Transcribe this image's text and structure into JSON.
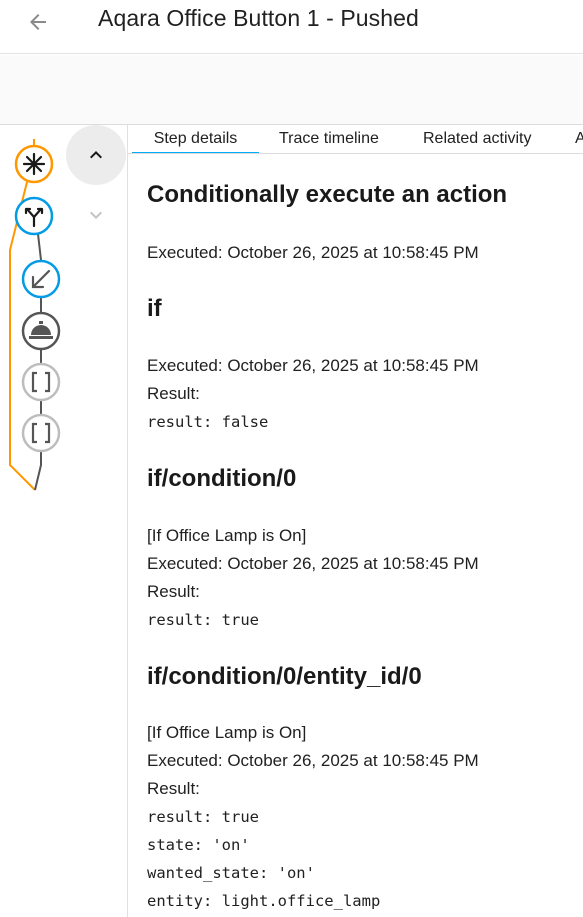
{
  "header": {
    "title": "Aqara Office Button 1 - Pushed",
    "back_icon": "arrow-left-icon"
  },
  "colors": {
    "trigger": "#ff9800",
    "choose": "#039be5",
    "action": "#039be5",
    "service": "#666666",
    "idle": "#bdbdbd",
    "tab_indicator": "#03a9f4"
  },
  "graph": {
    "nodes": [
      {
        "icon": "asterisk-icon",
        "state": "trigger"
      },
      {
        "icon": "call-split-icon",
        "state": "condition"
      },
      {
        "icon": "arrow-bottom-left-icon",
        "state": "action"
      },
      {
        "icon": "room-service-icon",
        "state": "service"
      },
      {
        "icon": "code-brackets-icon",
        "state": "idle"
      },
      {
        "icon": "code-brackets-icon",
        "state": "idle"
      }
    ]
  },
  "nav": {
    "up_icon": "chevron-up-icon",
    "down_icon": "chevron-down-icon"
  },
  "tabs": [
    {
      "label": "Step details",
      "active": true
    },
    {
      "label": "Trace timeline",
      "active": false
    },
    {
      "label": "Related activity",
      "active": false
    },
    {
      "label": "A",
      "active": false
    }
  ],
  "details": {
    "heading": "Conditionally execute an action",
    "executed": "Executed: October 26, 2025 at 10:58:45 PM",
    "sections": [
      {
        "title": "if",
        "executed": "Executed: October 26, 2025 at 10:58:45 PM",
        "result_label": "Result:",
        "result_lines": [
          "result: false"
        ]
      },
      {
        "title": "if/condition/0",
        "note": "[If Office Lamp is On]",
        "executed": "Executed: October 26, 2025 at 10:58:45 PM",
        "result_label": "Result:",
        "result_lines": [
          "result: true"
        ]
      },
      {
        "title": "if/condition/0/entity_id/0",
        "note": "[If Office Lamp is On]",
        "executed": "Executed: October 26, 2025 at 10:58:45 PM",
        "result_label": "Result:",
        "result_lines": [
          "result: true",
          "state: 'on'",
          "wanted_state: 'on'",
          "entity: light.office_lamp"
        ]
      }
    ]
  }
}
